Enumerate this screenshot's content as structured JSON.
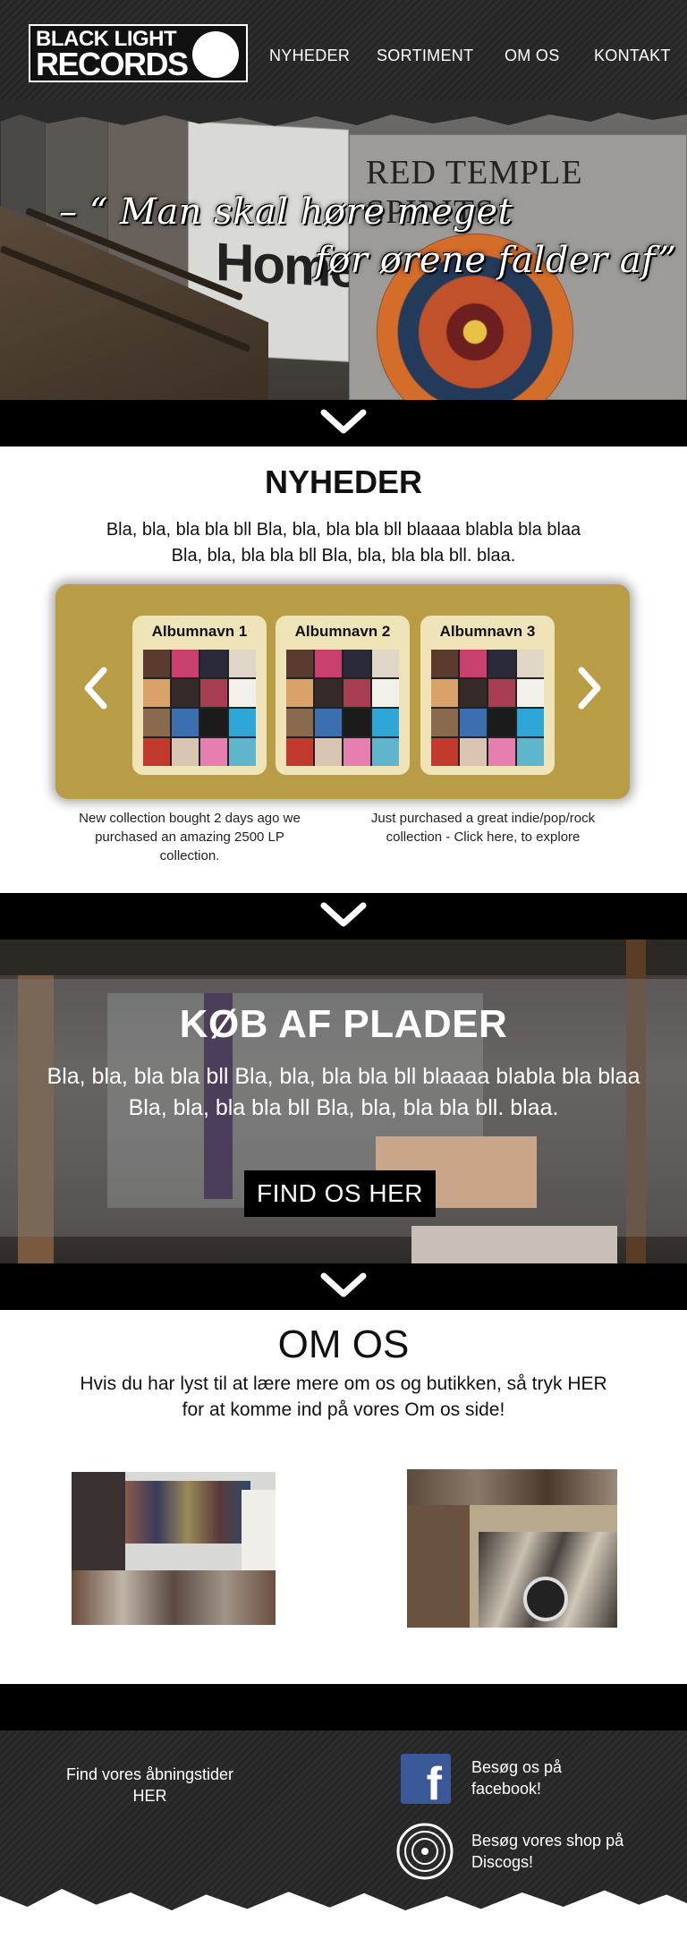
{
  "header": {
    "logo_line1": "BLACK LIGHT",
    "logo_line2": "RECORDS",
    "nav": [
      "NYHEDER",
      "SORTIMENT",
      "OM OS",
      "KONTAKT"
    ]
  },
  "hero": {
    "quote_line1": "– “ Man skal høre meget",
    "quote_line2": "før ørene falder af”",
    "record_labels": [
      "Home",
      "RED TEMPLE SPIRITS"
    ]
  },
  "news": {
    "title": "NYHEDER",
    "text_line1": "Bla, bla, bla bla bll Bla, bla, bla bla bll blaaaa blabla bla blaa",
    "text_line2": "Bla, bla, bla bla bll Bla, bla, bla bla bll. blaa.",
    "albums": [
      {
        "name": "Albumnavn 1"
      },
      {
        "name": "Albumnavn 2"
      },
      {
        "name": "Albumnavn 3"
      }
    ],
    "caption_left_1": "New collection bought 2 days ago we",
    "caption_left_2": "purchased an amazing 2500 LP collection.",
    "caption_right_1": "Just purchased a great indie/pop/rock",
    "caption_right_2": "collection - Click here, to explore"
  },
  "buy": {
    "title": "KØB AF PLADER",
    "text_line1": "Bla, bla, bla bla bll Bla, bla, bla bla bll blaaaa blabla bla blaa",
    "text_line2": "Bla, bla, bla bla bll Bla, bla, bla bla bll. blaa.",
    "button": "FIND OS HER"
  },
  "about": {
    "title": "OM OS",
    "text_line1": "Hvis du har lyst til at lære mere om os og butikken, så tryk HER",
    "text_line2": "for at komme ind på vores Om os side!"
  },
  "footer": {
    "hours_line1": "Find vores åbningstider",
    "hours_line2": "HER",
    "facebook_line1": "Besøg os på",
    "facebook_line2": "facebook!",
    "discogs_line1": "Besøg vores shop på",
    "discogs_line2": "Discogs!",
    "facebook_icon": "facebook-icon",
    "discogs_icon": "discogs-record-icon"
  },
  "colors": {
    "carousel": "#b89c46",
    "card": "#efe3b8",
    "band": "#000000",
    "facebook": "#3b5998"
  }
}
